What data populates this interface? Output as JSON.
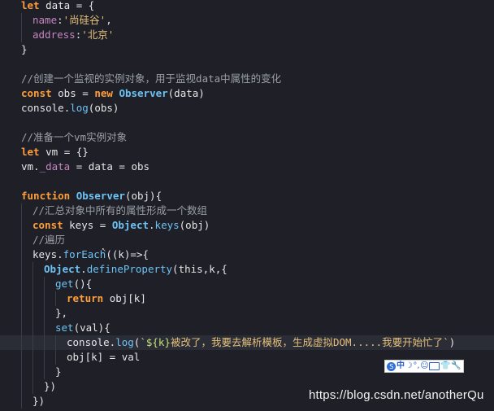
{
  "editor": {
    "lines": [
      {
        "indent": 0,
        "tokens": [
          [
            "kw",
            "let "
          ],
          [
            "var",
            "data "
          ],
          [
            "var",
            "= {"
          ]
        ]
      },
      {
        "indent": 1,
        "tokens": [
          [
            "prop",
            "name"
          ],
          [
            "var",
            ":"
          ],
          [
            "str",
            "'尚硅谷'"
          ],
          [
            "var",
            ","
          ]
        ]
      },
      {
        "indent": 1,
        "tokens": [
          [
            "prop",
            "address"
          ],
          [
            "var",
            ":"
          ],
          [
            "str",
            "'北京'"
          ]
        ]
      },
      {
        "indent": 0,
        "tokens": [
          [
            "var",
            "}"
          ]
        ]
      },
      {
        "indent": 0,
        "tokens": []
      },
      {
        "indent": 0,
        "tokens": [
          [
            "cmt",
            "//创建一个监视的实例对象，用于监视data中属性的变化"
          ]
        ]
      },
      {
        "indent": 0,
        "tokens": [
          [
            "kw",
            "const "
          ],
          [
            "var",
            "obs "
          ],
          [
            "var",
            "= "
          ],
          [
            "kw",
            "new "
          ],
          [
            "cls",
            "Observer"
          ],
          [
            "var",
            "(data)"
          ]
        ]
      },
      {
        "indent": 0,
        "tokens": [
          [
            "var",
            "console"
          ],
          [
            "var",
            "."
          ],
          [
            "fn",
            "log"
          ],
          [
            "var",
            "(obs)"
          ]
        ]
      },
      {
        "indent": 0,
        "tokens": []
      },
      {
        "indent": 0,
        "tokens": [
          [
            "cmt",
            "//准备一个vm实例对象"
          ]
        ]
      },
      {
        "indent": 0,
        "tokens": [
          [
            "kw",
            "let "
          ],
          [
            "var",
            "vm "
          ],
          [
            "var",
            "= {}"
          ]
        ]
      },
      {
        "indent": 0,
        "tokens": [
          [
            "var",
            "vm."
          ],
          [
            "prop",
            "_data"
          ],
          [
            "var",
            " = data = obs"
          ]
        ]
      },
      {
        "indent": 0,
        "tokens": []
      },
      {
        "indent": 0,
        "tokens": [
          [
            "kw",
            "function "
          ],
          [
            "cls",
            "Observer"
          ],
          [
            "var",
            "(obj){"
          ]
        ]
      },
      {
        "indent": 1,
        "tokens": [
          [
            "cmt",
            "//汇总对象中所有的属性形成一个数组"
          ]
        ]
      },
      {
        "indent": 1,
        "tokens": [
          [
            "kw",
            "const "
          ],
          [
            "var",
            "keys "
          ],
          [
            "var",
            "= "
          ],
          [
            "cls",
            "Object"
          ],
          [
            "var",
            "."
          ],
          [
            "fn",
            "keys"
          ],
          [
            "var",
            "(obj)"
          ]
        ]
      },
      {
        "indent": 1,
        "tokens": [
          [
            "cmt",
            "//遍历"
          ]
        ]
      },
      {
        "indent": 1,
        "tokens": [
          [
            "var",
            "keys."
          ],
          [
            "fn",
            "forEach"
          ],
          [
            "var",
            "((k)=>{"
          ]
        ]
      },
      {
        "indent": 2,
        "tokens": [
          [
            "cls",
            "Object"
          ],
          [
            "var",
            "."
          ],
          [
            "fn",
            "defineProperty"
          ],
          [
            "var",
            "(this,k,{"
          ]
        ]
      },
      {
        "indent": 3,
        "tokens": [
          [
            "fn",
            "get"
          ],
          [
            "var",
            "(){"
          ]
        ]
      },
      {
        "indent": 4,
        "tokens": [
          [
            "kw",
            "return "
          ],
          [
            "var",
            "obj[k]"
          ]
        ]
      },
      {
        "indent": 3,
        "tokens": [
          [
            "var",
            "},"
          ]
        ]
      },
      {
        "indent": 3,
        "tokens": [
          [
            "fn",
            "set"
          ],
          [
            "var",
            "(val){"
          ]
        ]
      },
      {
        "indent": 4,
        "highlight": true,
        "tokens": [
          [
            "var",
            "console."
          ],
          [
            "fn",
            "log"
          ],
          [
            "var",
            "("
          ],
          [
            "tpl",
            "`${k}"
          ],
          [
            "str",
            "被改了，我要去解析模板，生成虚拟DOM.....我要开始忙了"
          ],
          [
            "tpl",
            "`"
          ],
          [
            "var",
            ")"
          ]
        ]
      },
      {
        "indent": 4,
        "tokens": [
          [
            "var",
            "obj[k] = val"
          ]
        ]
      },
      {
        "indent": 3,
        "tokens": [
          [
            "var",
            "}"
          ]
        ]
      },
      {
        "indent": 2,
        "tokens": [
          [
            "var",
            "})"
          ]
        ]
      },
      {
        "indent": 1,
        "tokens": [
          [
            "var",
            "})"
          ]
        ]
      },
      {
        "indent": 0,
        "tokens": [
          [
            "var",
            "}"
          ]
        ]
      }
    ]
  },
  "ime_toolbar": {
    "logo": "S",
    "mode": "中",
    "moon": "☽",
    "dot": "°,",
    "smile": "☺",
    "shirt": "👕",
    "wrench": "🔧"
  },
  "watermark": "https://blog.csdn.net/anotherQu"
}
